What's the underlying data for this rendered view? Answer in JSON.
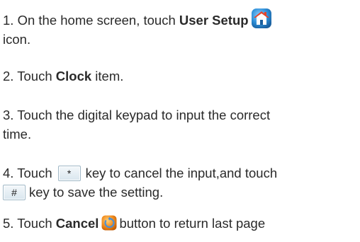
{
  "steps": [
    {
      "number": "1.",
      "pre": "On the home screen, touch",
      "bold": "User Setup",
      "icon": "home-icon",
      "post": "icon."
    },
    {
      "number": "2.",
      "pre": "Touch",
      "bold": "Clock",
      "post": "item."
    },
    {
      "number": "3.",
      "line1": "Touch the digital keypad to input the correct",
      "line2": "time."
    },
    {
      "number": "4.",
      "pre": "Touch",
      "key1": "*",
      "mid": "key to cancel the input,and touch",
      "key2": "#",
      "post": "key to save the setting."
    },
    {
      "number": "5.",
      "pre": "Touch",
      "bold": "Cancel",
      "icon": "cancel-icon",
      "post": "button to return last page"
    }
  ],
  "colors": {
    "text": "#2a2a2a",
    "home_icon_bg": "#2d8fd8",
    "home_icon_roof": "#e5452a",
    "cancel_icon": "#f08a1c",
    "key_border": "#9fb7c6"
  }
}
